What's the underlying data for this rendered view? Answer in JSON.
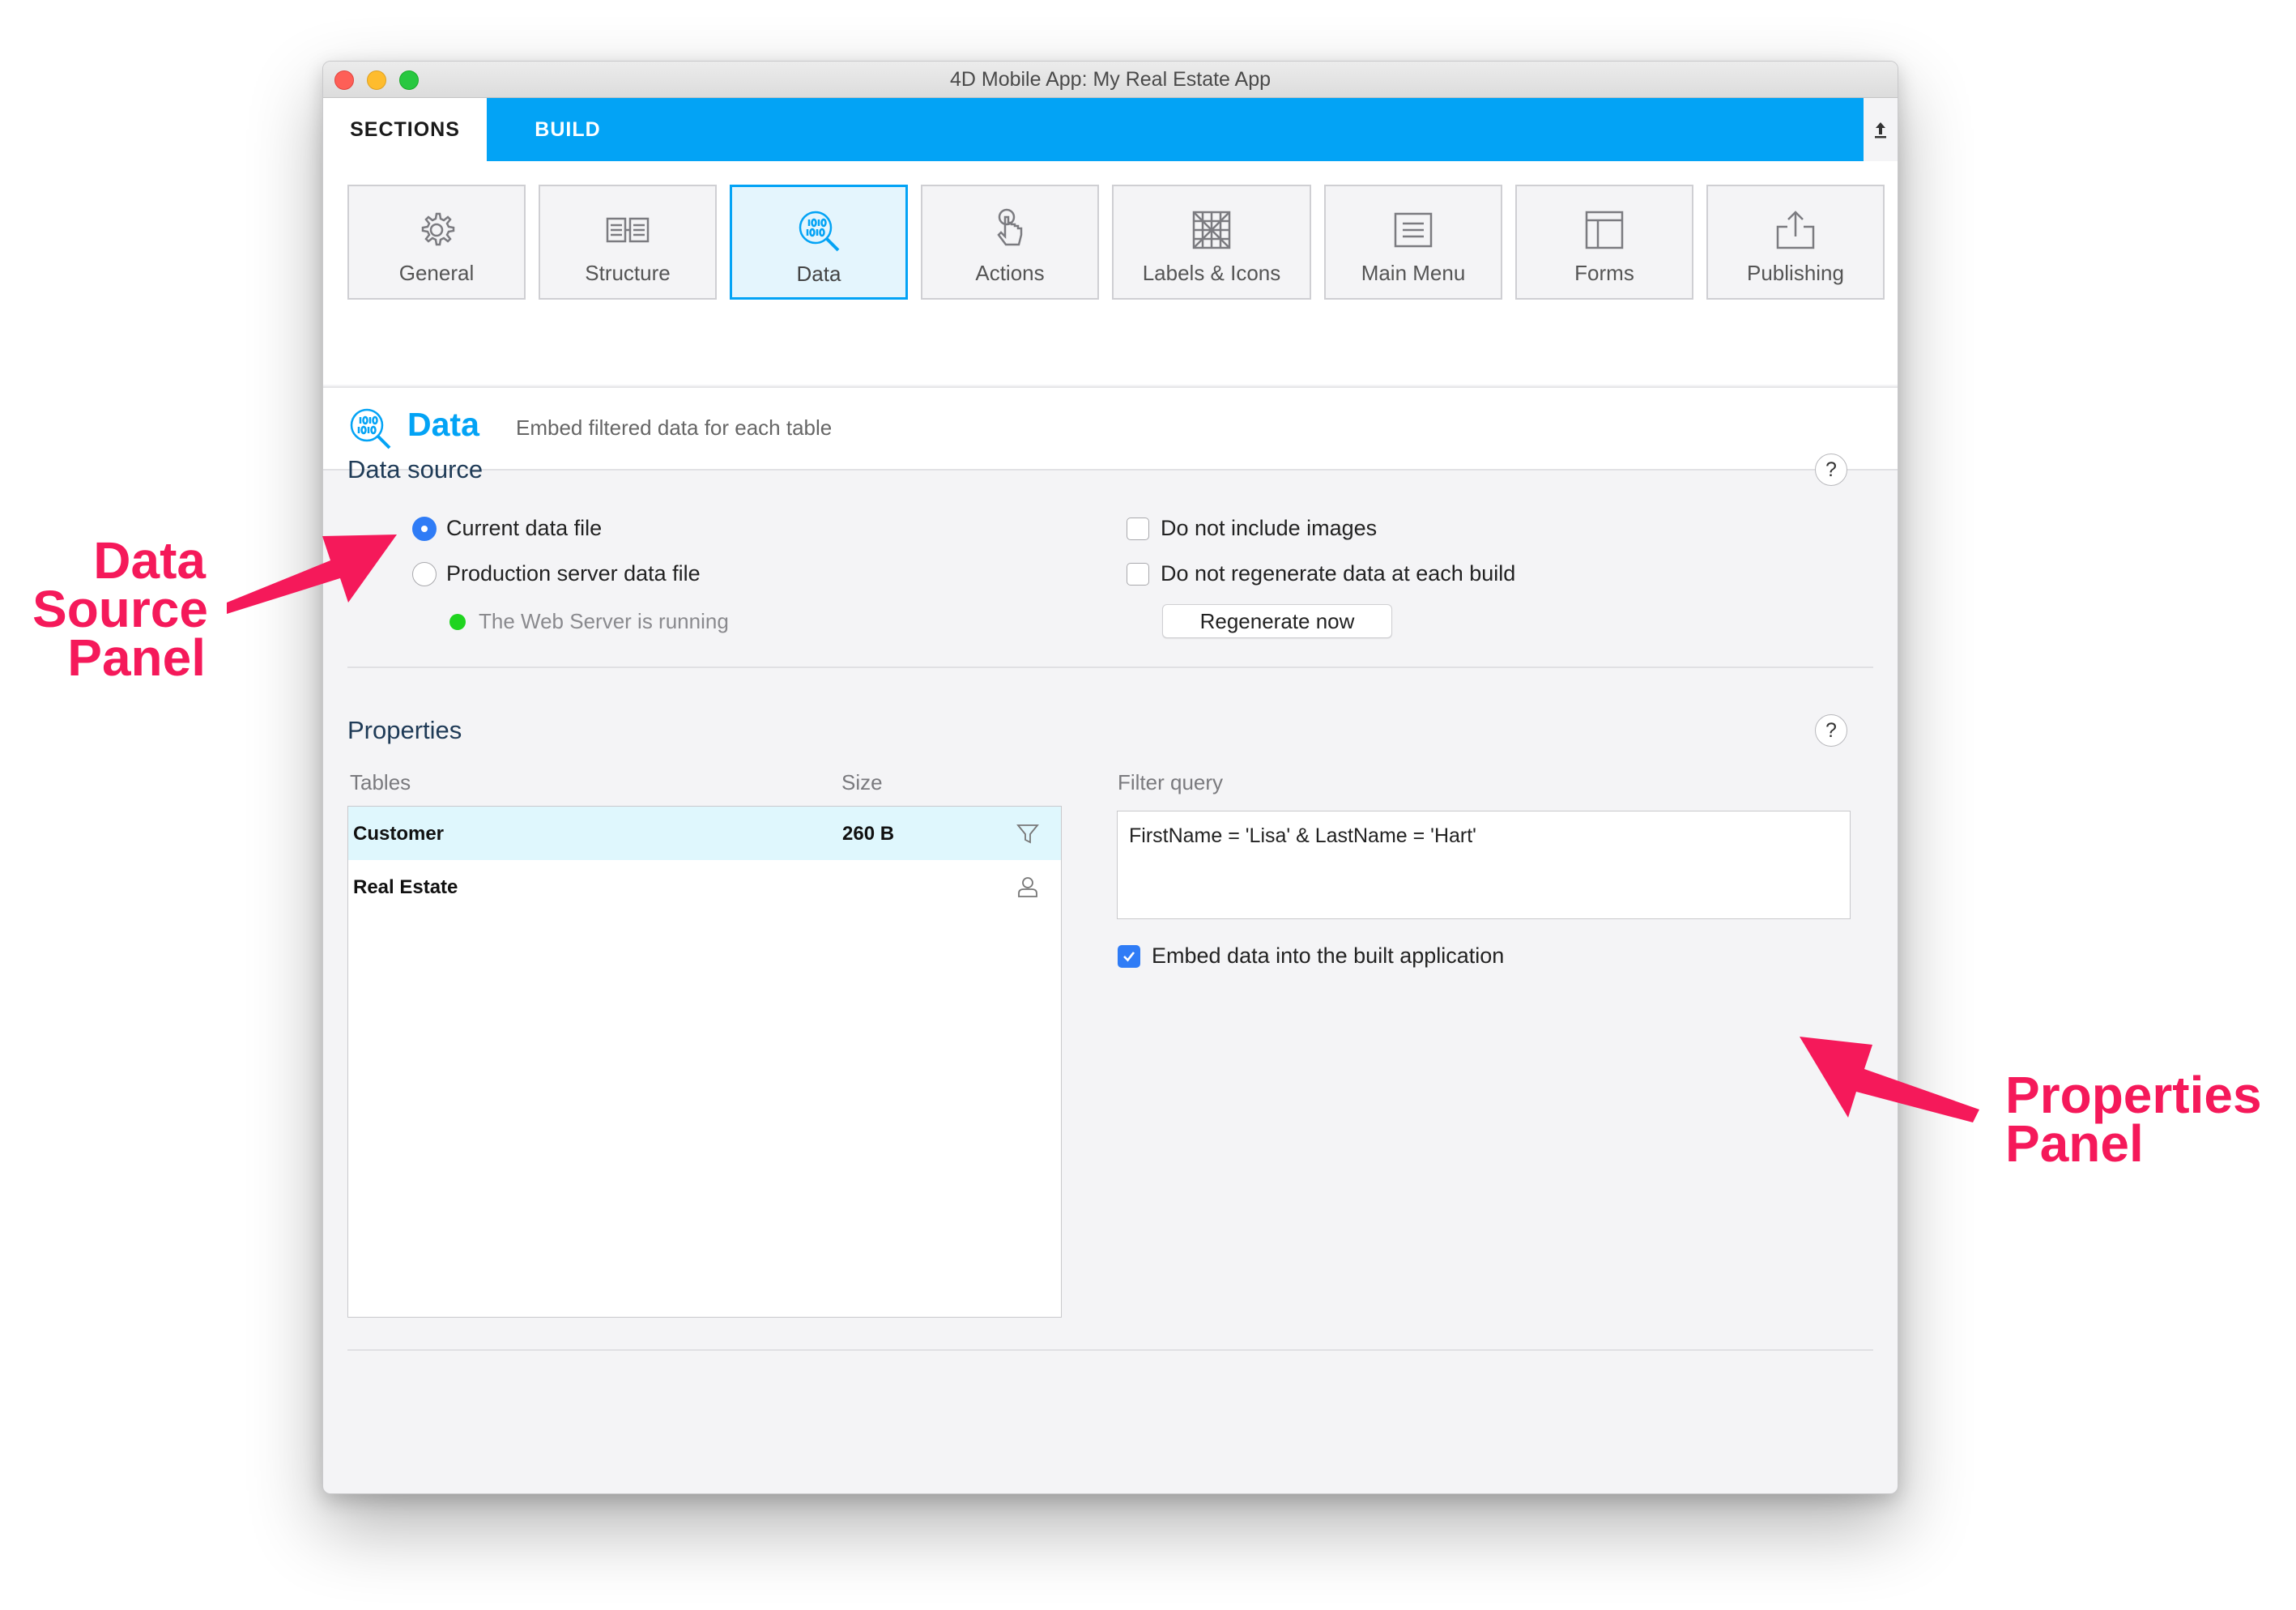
{
  "window": {
    "title": "4D Mobile App: My Real Estate App"
  },
  "tabs": {
    "sections": "SECTIONS",
    "build": "BUILD",
    "collapse_icon": "upload-arrow-icon"
  },
  "sections": [
    {
      "label": "General",
      "icon": "gear-icon"
    },
    {
      "label": "Structure",
      "icon": "structure-icon"
    },
    {
      "label": "Data",
      "icon": "data-search-icon"
    },
    {
      "label": "Actions",
      "icon": "tap-hand-icon"
    },
    {
      "label": "Labels & Icons",
      "icon": "labels-grid-icon"
    },
    {
      "label": "Main Menu",
      "icon": "menu-list-icon"
    },
    {
      "label": "Forms",
      "icon": "form-layout-icon"
    },
    {
      "label": "Publishing",
      "icon": "share-upload-icon"
    }
  ],
  "header": {
    "title": "Data",
    "subtitle": "Embed filtered data for each table"
  },
  "data_source": {
    "heading": "Data source",
    "help": "?",
    "radio_current": "Current data file",
    "radio_production": "Production server data file",
    "server_status": "The Web Server is running",
    "check_no_images": "Do not include images",
    "check_no_regen": "Do not regenerate data at each build",
    "regen_button": "Regenerate now"
  },
  "properties": {
    "heading": "Properties",
    "help": "?",
    "col_tables": "Tables",
    "col_size": "Size",
    "col_filter": "Filter query",
    "rows": [
      {
        "name": "Customer",
        "size": "260 B",
        "icon": "filter-icon"
      },
      {
        "name": "Real Estate",
        "size": "",
        "icon": "user-icon"
      }
    ],
    "filter_query": "FirstName = 'Lisa' & LastName = 'Hart'",
    "embed_check": "Embed data into the built application"
  },
  "annotations": {
    "left": [
      "Data",
      "Source",
      "Panel"
    ],
    "right": [
      "Properties",
      "Panel"
    ],
    "color": "#f5195a"
  },
  "colors": {
    "accent": "#03a3f5",
    "radio_on": "#2f7cf6",
    "status_green": "#1fd41f"
  }
}
